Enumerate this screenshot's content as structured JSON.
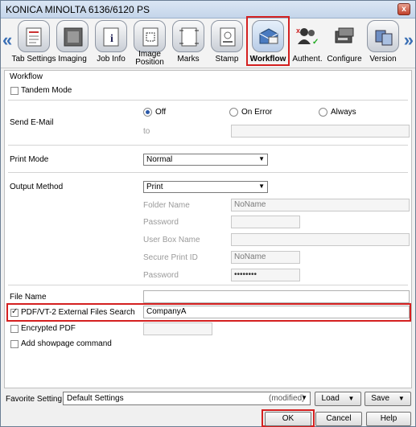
{
  "window": {
    "title": "KONICA MINOLTA 6136/6120 PS",
    "close_glyph": "x"
  },
  "toolbar": {
    "scroll_left_glyph": "«",
    "scroll_right_glyph": "»",
    "tabs": [
      {
        "label": "Tab Settings",
        "icon": "tab-settings-icon"
      },
      {
        "label": "Imaging",
        "icon": "imaging-icon"
      },
      {
        "label": "Job Info",
        "icon": "job-info-icon"
      },
      {
        "label": "Image Position",
        "icon": "image-position-icon"
      },
      {
        "label": "Marks",
        "icon": "marks-icon"
      },
      {
        "label": "Stamp",
        "icon": "stamp-icon"
      },
      {
        "label": "Workflow",
        "icon": "workflow-icon",
        "active": true
      },
      {
        "label": "Authent.",
        "icon": "authentication-icon"
      },
      {
        "label": "Configure",
        "icon": "configure-icon"
      },
      {
        "label": "Version",
        "icon": "version-icon"
      }
    ]
  },
  "panel": {
    "section_title": "Workflow",
    "tandem_mode": {
      "label": "Tandem Mode",
      "checked": false
    },
    "send_email": {
      "label": "Send E-Mail",
      "options": [
        "Off",
        "On Error",
        "Always"
      ],
      "selected": "Off",
      "to_label": "to",
      "to_value": ""
    },
    "print_mode": {
      "label": "Print Mode",
      "value": "Normal"
    },
    "output_method": {
      "label": "Output Method",
      "value": "Print",
      "folder_name_label": "Folder Name",
      "folder_name_value": "NoName",
      "password_label": "Password",
      "password_value": "",
      "user_box_name_label": "User Box Name",
      "user_box_name_value": "",
      "secure_print_id_label": "Secure Print ID",
      "secure_print_id_value": "NoName",
      "secure_password_label": "Password",
      "secure_password_value": "••••••••"
    },
    "file_name": {
      "label": "File Name",
      "value": ""
    },
    "pdf_vt2": {
      "label": "PDF/VT-2 External Files Search",
      "checked": true,
      "value": "CompanyA"
    },
    "encrypted_pdf": {
      "label": "Encrypted PDF",
      "checked": false,
      "value": ""
    },
    "add_showpage": {
      "label": "Add showpage command",
      "checked": false
    }
  },
  "footer": {
    "favorite_label": "Favorite Setting",
    "favorite_value": "Default Settings",
    "favorite_status": "(modified)",
    "load_label": "Load",
    "save_label": "Save",
    "ok_label": "OK",
    "cancel_label": "Cancel",
    "help_label": "Help"
  },
  "colors": {
    "highlight": "#d42020",
    "accent": "#3a6fb5"
  }
}
